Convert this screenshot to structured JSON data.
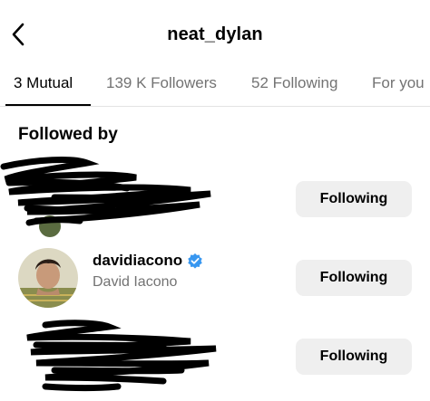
{
  "header": {
    "title": "neat_dylan",
    "back_icon": "chevron-left-icon"
  },
  "tabs": [
    {
      "label": "3 Mutual",
      "active": true
    },
    {
      "label": "139 K Followers",
      "active": false
    },
    {
      "label": "52 Following",
      "active": false
    },
    {
      "label": "For you",
      "active": false
    }
  ],
  "section_title": "Followed by",
  "rows": [
    {
      "username": "",
      "fullname": "",
      "redacted": true,
      "button_label": "Following"
    },
    {
      "username": "davidiacono",
      "fullname": "David Iacono",
      "verified": true,
      "redacted": false,
      "button_label": "Following"
    },
    {
      "username": "",
      "fullname": "",
      "redacted": true,
      "button_label": "Following"
    }
  ],
  "colors": {
    "text_primary": "#000000",
    "text_secondary": "#737373",
    "button_bg": "#efefef",
    "verified_blue": "#3897f0",
    "divider": "#e3e3e3"
  }
}
